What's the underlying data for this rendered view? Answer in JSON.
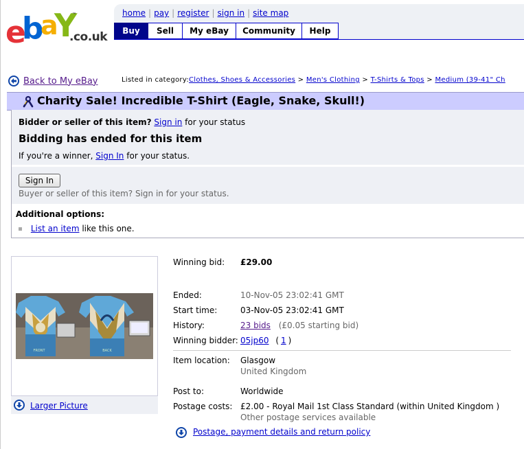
{
  "logo": {
    "e": "e",
    "b": "b",
    "a": "a",
    "y": "Y",
    "tm": "™",
    "domain": ".co.uk"
  },
  "top_links": [
    "home",
    "pay",
    "register",
    "sign in",
    "site map"
  ],
  "nav_tabs": [
    "Buy",
    "Sell",
    "My eBay",
    "Community",
    "Help"
  ],
  "back_link": "Back to My eBay",
  "category": {
    "prefix": "Listed in category:",
    "items": [
      "Clothes, Shoes & Accessories",
      "Men's Clothing",
      "T-Shirts & Tops",
      "Medium (39-41\" Ch"
    ],
    "separator": ">"
  },
  "item_title": "Charity Sale! Incredible T-Shirt (Eagle, Snake, Skull!)",
  "status": {
    "bidder_prefix": "Bidder or seller of this item?",
    "bidder_link": "Sign in",
    "bidder_suffix": "for your status",
    "ended": "Bidding has ended for this item",
    "winner_prefix": "If you're a winner,",
    "winner_link": "Sign In",
    "winner_suffix": "for your status.",
    "signin_button": "Sign In",
    "signin_note": "Buyer or seller of this item? Sign in for your status.",
    "additional_options": "Additional options:",
    "list_link": "List an item",
    "list_suffix": "like this one."
  },
  "picture": {
    "front_label": "FRONT",
    "back_label": "BACK",
    "larger_link": "Larger Picture"
  },
  "details": {
    "winning_bid_label": "Winning bid:",
    "winning_bid": "£29.00",
    "ended_label": "Ended:",
    "ended": "10-Nov-05 23:02:41 GMT",
    "start_label": "Start time:",
    "start": "03-Nov-05 23:02:41 GMT",
    "history_label": "History:",
    "bids": "23 bids",
    "starting_bid": "(£0.05 starting bid)",
    "winner_label": "Winning bidder:",
    "winner": "05jp60",
    "feedback_open": "(",
    "feedback": "1",
    "feedback_close": ")",
    "location_label": "Item location:",
    "location_city": "Glasgow",
    "location_country": "United Kingdom",
    "post_label": "Post to:",
    "post_to": "Worldwide",
    "postage_label": "Postage costs:",
    "postage": "£2.00 - Royal Mail 1st Class Standard (within United Kingdom )",
    "postage_other": "Other postage services available",
    "return_link": "Postage, payment details and return policy"
  }
}
